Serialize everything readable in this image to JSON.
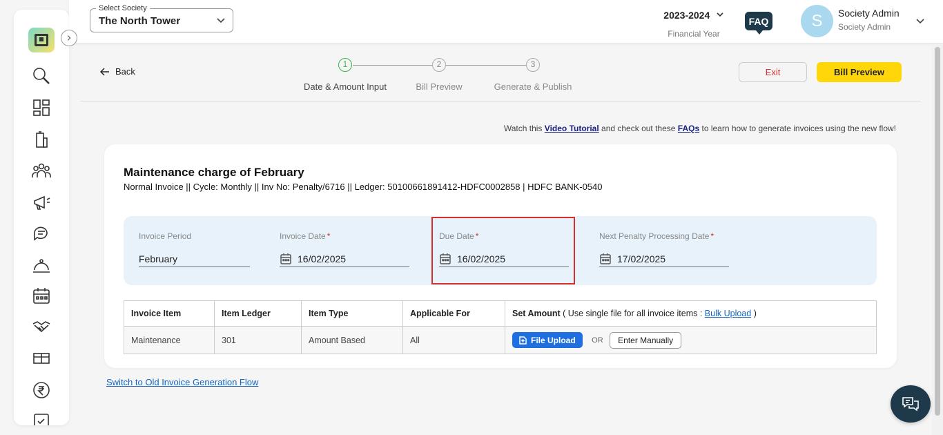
{
  "header": {
    "society_label": "Select Society",
    "society_value": "The North Tower",
    "financial_year": "2023-2024",
    "financial_year_label": "Financial Year",
    "faq": "FAQ",
    "avatar_initial": "S",
    "user_name": "Society Admin",
    "user_role": "Society Admin"
  },
  "sidebar": {
    "icons": [
      "search-icon",
      "dashboard-icon",
      "building-icon",
      "members-icon",
      "announcement-icon",
      "chat-icon",
      "service-icon",
      "calendar-icon",
      "handshake-icon",
      "package-icon",
      "rupee-icon",
      "task-icon"
    ]
  },
  "steps": {
    "back": "Back",
    "items": [
      {
        "num": "1",
        "label": "Date & Amount Input"
      },
      {
        "num": "2",
        "label": "Bill Preview"
      },
      {
        "num": "3",
        "label": "Generate & Publish"
      }
    ],
    "exit": "Exit",
    "bill_preview": "Bill Preview"
  },
  "tutorial": {
    "prefix": "Watch this",
    "video_link": "Video Tutorial",
    "middle": "and check out these",
    "faqs_link": "FAQs",
    "suffix": "to learn how to generate invoices using the new flow!"
  },
  "invoice": {
    "title": "Maintenance charge of February",
    "subtitle": "Normal Invoice || Cycle: Monthly || Inv No: Penalty/6716 || Ledger: 50100661891412-HDFC0002858 | HDFC BANK-0540",
    "fields": {
      "period_label": "Invoice Period",
      "period_value": "February",
      "invoice_date_label": "Invoice Date",
      "invoice_date_value": "16/02/2025",
      "due_date_label": "Due Date",
      "due_date_value": "16/02/2025",
      "penalty_date_label": "Next Penalty Processing Date",
      "penalty_date_value": "17/02/2025",
      "required_mark": "*"
    }
  },
  "table": {
    "headers": {
      "item": "Invoice Item",
      "ledger": "Item Ledger",
      "type": "Item Type",
      "applicable": "Applicable For",
      "set_amount": "Set Amount",
      "set_amount_note_prefix": "( Use single file for all invoice items :",
      "bulk_upload": "Bulk Upload",
      "set_amount_note_suffix": ")"
    },
    "rows": [
      {
        "item": "Maintenance",
        "ledger": "301",
        "type": "Amount Based",
        "applicable": "All"
      }
    ],
    "file_upload": "File Upload",
    "or": "OR",
    "enter_manually": "Enter Manually"
  },
  "switch_link": "Switch to Old Invoice Generation Flow",
  "colors": {
    "accent_yellow": "#ffd60a",
    "primary_blue": "#1f6fe0",
    "dark_navy": "#1e3a4a",
    "highlight_red": "#d32f2f",
    "step_active": "#3bb54a"
  }
}
